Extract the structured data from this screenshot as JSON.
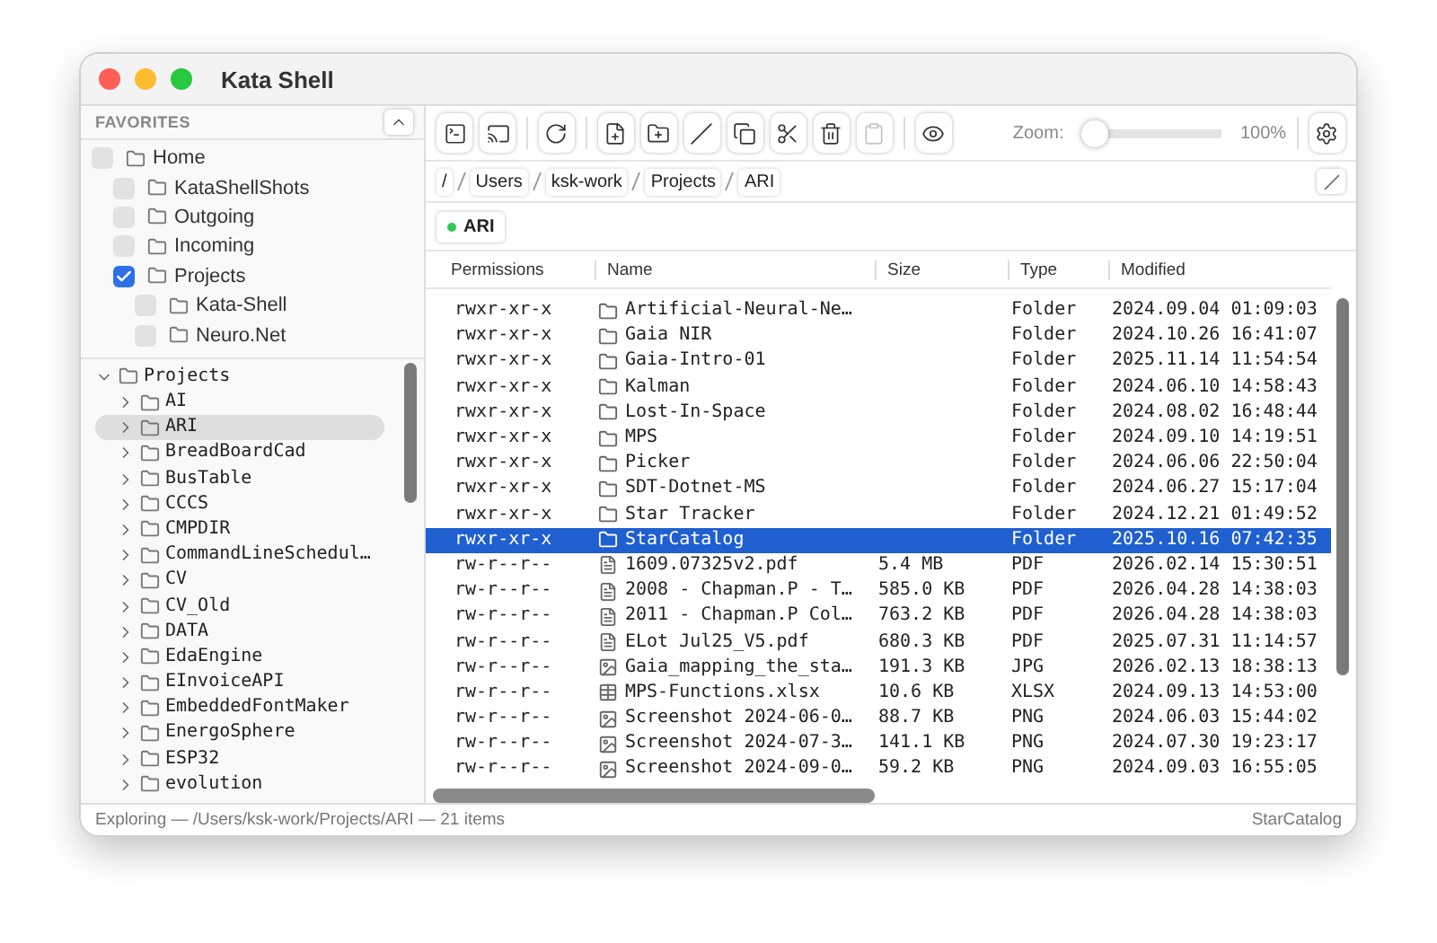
{
  "window": {
    "title": "Kata Shell"
  },
  "favorites": {
    "title": "FAVORITES",
    "items": [
      {
        "label": "Home",
        "checked": false,
        "children": [
          {
            "label": "KataShellShots",
            "checked": false
          },
          {
            "label": "Outgoing",
            "checked": false
          },
          {
            "label": "Incoming",
            "checked": false
          },
          {
            "label": "Projects",
            "checked": true,
            "children": [
              {
                "label": "Kata-Shell",
                "checked": false
              },
              {
                "label": "Neuro.Net",
                "checked": false
              }
            ]
          }
        ]
      }
    ]
  },
  "tree": [
    {
      "label": "Projects",
      "expanded": true,
      "selected": false,
      "children": [
        {
          "label": "AI",
          "expanded": false,
          "selected": false
        },
        {
          "label": "ARI",
          "expanded": false,
          "selected": true
        },
        {
          "label": "BreadBoardCad",
          "expanded": false,
          "selected": false
        },
        {
          "label": "BusTable",
          "expanded": false,
          "selected": false
        },
        {
          "label": "CCCS",
          "expanded": false,
          "selected": false
        },
        {
          "label": "CMPDIR",
          "expanded": false,
          "selected": false
        },
        {
          "label": "CommandLineSchedul…",
          "expanded": false,
          "selected": false
        },
        {
          "label": "CV",
          "expanded": false,
          "selected": false
        },
        {
          "label": "CV_Old",
          "expanded": false,
          "selected": false
        },
        {
          "label": "DATA",
          "expanded": false,
          "selected": false
        },
        {
          "label": "EdaEngine",
          "expanded": false,
          "selected": false
        },
        {
          "label": "EInvoiceAPI",
          "expanded": false,
          "selected": false
        },
        {
          "label": "EmbeddedFontMaker",
          "expanded": false,
          "selected": false
        },
        {
          "label": "EnergoSphere",
          "expanded": false,
          "selected": false
        },
        {
          "label": "ESP32",
          "expanded": false,
          "selected": false
        },
        {
          "label": "evolution",
          "expanded": false,
          "selected": false
        }
      ]
    }
  ],
  "toolbar": {
    "groups": [
      [
        {
          "kind": "terminal",
          "disabled": false
        },
        {
          "kind": "screen",
          "disabled": false
        }
      ],
      [
        {
          "kind": "refresh",
          "disabled": false
        }
      ],
      [
        {
          "kind": "new-file",
          "disabled": false
        },
        {
          "kind": "new-folder",
          "disabled": false
        },
        {
          "kind": "rename",
          "disabled": false
        },
        {
          "kind": "copy",
          "disabled": false
        },
        {
          "kind": "cut",
          "disabled": false
        },
        {
          "kind": "delete",
          "disabled": false
        },
        {
          "kind": "paste",
          "disabled": true
        }
      ],
      [
        {
          "kind": "preview",
          "disabled": false
        }
      ]
    ],
    "zoom": {
      "label": "Zoom:",
      "level": 0.0,
      "reading": "100%"
    },
    "end_button": {
      "kind": "settings",
      "disabled": false
    }
  },
  "breadcrumb": [
    "/",
    "Users",
    "ksk-work",
    "Projects",
    "ARI"
  ],
  "tabs": [
    {
      "label": "ARI",
      "selected": true,
      "color": "#34c759"
    }
  ],
  "table": {
    "columns": [
      "Permissions",
      "Name",
      "Size",
      "Type",
      "Modified"
    ],
    "rows": [
      {
        "permissions": "rwxr-xr-x",
        "name": "Artificial-Neural-Ne…",
        "size": "",
        "type": "Folder",
        "modified": "2024.09.04 01:09:03",
        "kind": "folder",
        "selected": false
      },
      {
        "permissions": "rwxr-xr-x",
        "name": "Gaia NIR",
        "size": "",
        "type": "Folder",
        "modified": "2024.10.26 16:41:07",
        "kind": "folder",
        "selected": false
      },
      {
        "permissions": "rwxr-xr-x",
        "name": "Gaia-Intro-01",
        "size": "",
        "type": "Folder",
        "modified": "2025.11.14 11:54:54",
        "kind": "folder",
        "selected": false
      },
      {
        "permissions": "rwxr-xr-x",
        "name": "Kalman",
        "size": "",
        "type": "Folder",
        "modified": "2024.06.10 14:58:43",
        "kind": "folder",
        "selected": false
      },
      {
        "permissions": "rwxr-xr-x",
        "name": "Lost-In-Space",
        "size": "",
        "type": "Folder",
        "modified": "2024.08.02 16:48:44",
        "kind": "folder",
        "selected": false
      },
      {
        "permissions": "rwxr-xr-x",
        "name": "MPS",
        "size": "",
        "type": "Folder",
        "modified": "2024.09.10 14:19:51",
        "kind": "folder",
        "selected": false
      },
      {
        "permissions": "rwxr-xr-x",
        "name": "Picker",
        "size": "",
        "type": "Folder",
        "modified": "2024.06.06 22:50:04",
        "kind": "folder",
        "selected": false
      },
      {
        "permissions": "rwxr-xr-x",
        "name": "SDT-Dotnet-MS",
        "size": "",
        "type": "Folder",
        "modified": "2024.06.27 15:17:04",
        "kind": "folder",
        "selected": false
      },
      {
        "permissions": "rwxr-xr-x",
        "name": "Star Tracker",
        "size": "",
        "type": "Folder",
        "modified": "2024.12.21 01:49:52",
        "kind": "folder",
        "selected": false
      },
      {
        "permissions": "rwxr-xr-x",
        "name": "StarCatalog",
        "size": "",
        "type": "Folder",
        "modified": "2025.10.16 07:42:35",
        "kind": "folder",
        "selected": true
      },
      {
        "permissions": "rw-r--r--",
        "name": "1609.07325v2.pdf",
        "size": "5.4 MB",
        "type": "PDF",
        "modified": "2026.02.14 15:30:51",
        "kind": "pdf",
        "selected": false
      },
      {
        "permissions": "rw-r--r--",
        "name": "2008 - Chapman.P - T…",
        "size": "585.0 KB",
        "type": "PDF",
        "modified": "2026.04.28 14:38:03",
        "kind": "pdf",
        "selected": false
      },
      {
        "permissions": "rw-r--r--",
        "name": "2011 - Chapman.P Col…",
        "size": "763.2 KB",
        "type": "PDF",
        "modified": "2026.04.28 14:38:03",
        "kind": "pdf",
        "selected": false
      },
      {
        "permissions": "rw-r--r--",
        "name": "ELot Jul25_V5.pdf",
        "size": "680.3 KB",
        "type": "PDF",
        "modified": "2025.07.31 11:14:57",
        "kind": "pdf",
        "selected": false
      },
      {
        "permissions": "rw-r--r--",
        "name": "Gaia_mapping_the_sta…",
        "size": "191.3 KB",
        "type": "JPG",
        "modified": "2026.02.13 18:38:13",
        "kind": "image",
        "selected": false
      },
      {
        "permissions": "rw-r--r--",
        "name": "MPS-Functions.xlsx",
        "size": "10.6 KB",
        "type": "XLSX",
        "modified": "2024.09.13 14:53:00",
        "kind": "sheet",
        "selected": false
      },
      {
        "permissions": "rw-r--r--",
        "name": "Screenshot 2024-06-0…",
        "size": "88.7 KB",
        "type": "PNG",
        "modified": "2024.06.03 15:44:02",
        "kind": "image",
        "selected": false
      },
      {
        "permissions": "rw-r--r--",
        "name": "Screenshot 2024-07-3…",
        "size": "141.1 KB",
        "type": "PNG",
        "modified": "2024.07.30 19:23:17",
        "kind": "image",
        "selected": false
      },
      {
        "permissions": "rw-r--r--",
        "name": "Screenshot 2024-09-0…",
        "size": "59.2 KB",
        "type": "PNG",
        "modified": "2024.09.03 16:55:05",
        "kind": "image",
        "selected": false
      }
    ]
  },
  "status_bar": {
    "left": "Exploring — /Users/ksk-work/Projects/ARI — 21 items",
    "right": "StarCatalog"
  }
}
